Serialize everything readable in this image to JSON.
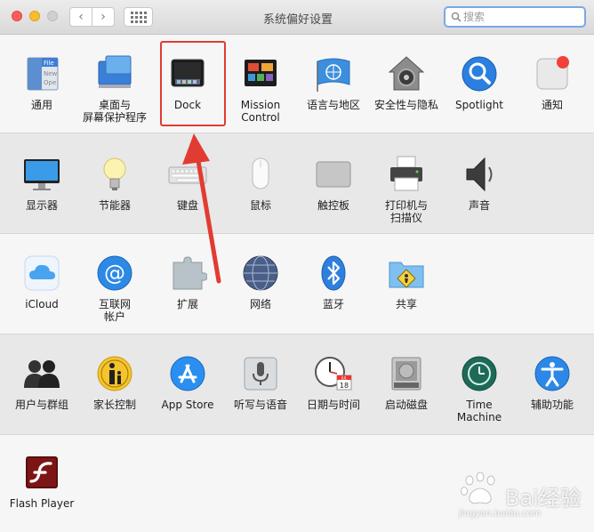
{
  "window": {
    "title": "系统偏好设置"
  },
  "search": {
    "placeholder": "搜索"
  },
  "rows": [
    [
      {
        "label": "通用"
      },
      {
        "label": "桌面与\n屏幕保护程序"
      },
      {
        "label": "Dock"
      },
      {
        "label": "Mission\nControl"
      },
      {
        "label": "语言与地区"
      },
      {
        "label": "安全性与隐私"
      },
      {
        "label": "Spotlight"
      },
      {
        "label": "通知"
      }
    ],
    [
      {
        "label": "显示器"
      },
      {
        "label": "节能器"
      },
      {
        "label": "键盘"
      },
      {
        "label": "鼠标"
      },
      {
        "label": "触控板"
      },
      {
        "label": "打印机与\n扫描仪"
      },
      {
        "label": "声音"
      }
    ],
    [
      {
        "label": "iCloud"
      },
      {
        "label": "互联网\n帐户"
      },
      {
        "label": "扩展"
      },
      {
        "label": "网络"
      },
      {
        "label": "蓝牙"
      },
      {
        "label": "共享"
      }
    ],
    [
      {
        "label": "用户与群组"
      },
      {
        "label": "家长控制"
      },
      {
        "label": "App Store"
      },
      {
        "label": "听写与语音"
      },
      {
        "label": "日期与时间"
      },
      {
        "label": "启动磁盘"
      },
      {
        "label": "Time Machine"
      },
      {
        "label": "辅助功能"
      }
    ],
    [
      {
        "label": "Flash Player"
      }
    ]
  ],
  "icon_text": {
    "general_lines": [
      "File",
      "New",
      "Ope"
    ],
    "calendar_month": "JUL",
    "calendar_day": "18"
  },
  "watermark": {
    "brand": "Bai经验",
    "url": "jingyan.baidu.com"
  },
  "colors": {
    "highlight": "#e13c31",
    "search_focus": "#79a8e8"
  }
}
